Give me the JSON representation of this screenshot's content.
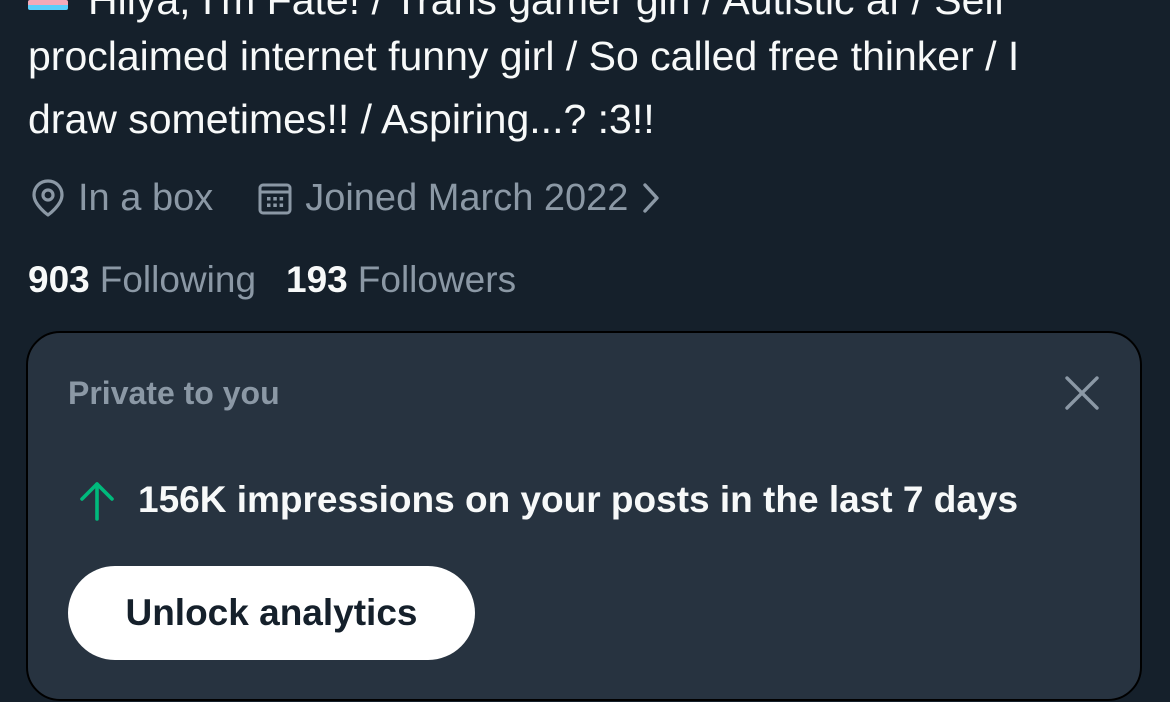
{
  "bio": {
    "lines": [
      "Hiiya, I'm Fate! / Trans gamer girl / Autistic af / Self",
      "proclaimed internet funny girl / So called free thinker / I",
      "draw sometimes!! / Aspiring...? :3!!"
    ],
    "flag_icon": "trans-flag-emoji"
  },
  "meta": {
    "location": "In a box",
    "location_icon": "location-pin-icon",
    "joined": "Joined March 2022",
    "joined_icon": "calendar-icon",
    "chevron_icon": "chevron-right-icon"
  },
  "stats": {
    "following_count": "903",
    "following_label": "Following",
    "followers_count": "193",
    "followers_label": "Followers"
  },
  "card": {
    "title": "Private to you",
    "close_icon": "close-icon",
    "impressions_text": "156K impressions on your posts in the last 7 days",
    "trend_icon": "arrow-up-icon",
    "button_label": "Unlock analytics"
  },
  "colors": {
    "background": "#15202b",
    "card_background": "#273340",
    "text_primary": "#f7f9f9",
    "text_secondary": "#8b98a5",
    "trend_green": "#00ba7c",
    "button_background": "#ffffff",
    "button_text": "#15202b"
  }
}
